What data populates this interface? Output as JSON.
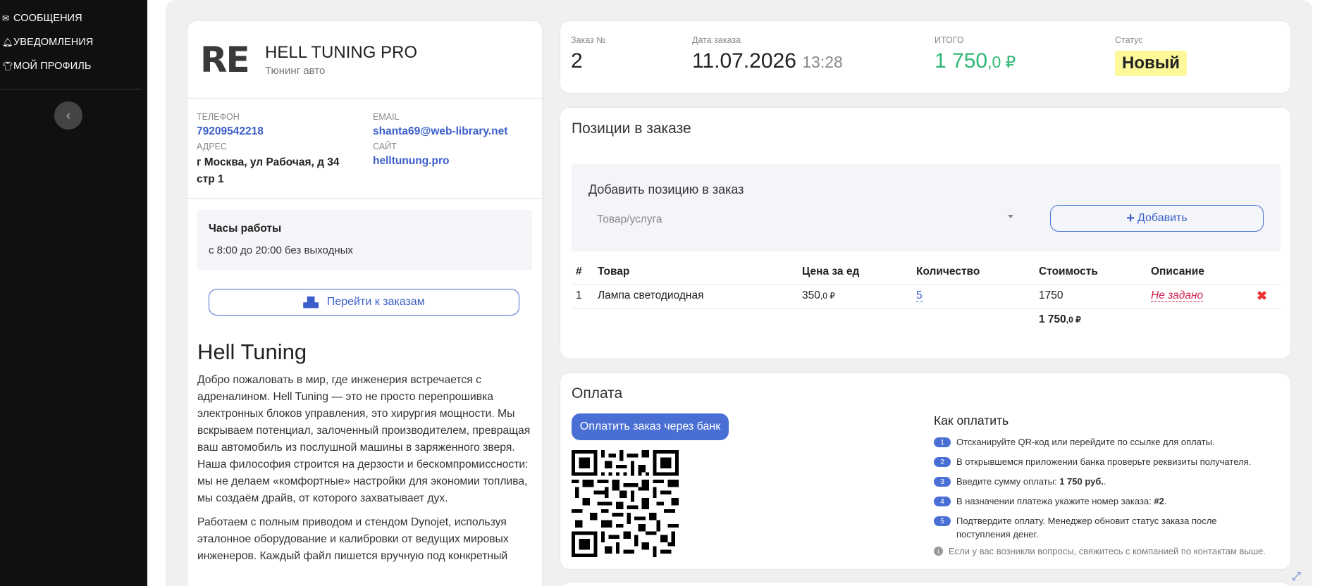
{
  "sidebar": {
    "items": [
      {
        "label": "СООБЩЕНИЯ",
        "icon": "envelope-icon"
      },
      {
        "label": "УВЕДОМЛЕНИЯ",
        "icon": "bell-icon"
      },
      {
        "label": "МОЙ ПРОФИЛЬ",
        "icon": "shirt-icon"
      }
    ],
    "collapse_glyph": "‹"
  },
  "company": {
    "logo": "RE",
    "name": "HELL TUNING PRO",
    "subtitle": "Тюнинг авто",
    "phone_label": "ТЕЛЕФОН",
    "phone": "79209542218",
    "email_label": "EMAIL",
    "email": "shanta69@web-library.net",
    "address_label": "АДРЕС",
    "address": "г Москва, ул Рабочая, д 34 стр 1",
    "site_label": "САЙТ",
    "site": "helltunung.pro",
    "hours_title": "Часы работы",
    "hours_text": "с 8:00 до 20:00 без выходных",
    "orders_button": "Перейти к заказам",
    "about_title": "Hell Tuning",
    "about_p1": "Добро пожаловать в мир, где инженерия встречается с адреналином. Hell Tuning — это не просто перепрошивка электронных блоков управления, это хирургия мощности. Мы вскрываем потенциал, залоченный производителем, превращая ваш автомобиль из послушной машины в заряженного зверя. Наша философия строится на дерзости и бескомпромиссности: мы не делаем «комфортные» настройки для экономии топлива, мы создаём драйв, от которого захватывает дух.",
    "about_p2": "Работаем с полным приводом и стендом Dynojet, используя эталонное оборудование и калибровки от ведущих мировых инженеров. Каждый файл пишется вручную под конкретный"
  },
  "order": {
    "number_label": "Заказ №",
    "number": "2",
    "date_label": "Дата заказа",
    "date": "11.07.2026",
    "time": "13:28",
    "total_label": "ИТОГО",
    "total_int": "1 750",
    "total_frac": ",0 ₽",
    "status_label": "Статус",
    "status": "Новый"
  },
  "positions": {
    "title": "Позиции в заказе",
    "add_title": "Добавить позицию в заказ",
    "select_placeholder": "Товар/услуга",
    "add_button": "Добавить",
    "columns": [
      "#",
      "Товар",
      "Цена за ед",
      "Количество",
      "Стоимость",
      "Описание"
    ],
    "rows": [
      {
        "n": "1",
        "product": "Лампа светодиодная",
        "price_int": "350",
        "price_frac": ",0 ₽",
        "qty": "5",
        "cost": "1750",
        "desc": "Не задано"
      }
    ],
    "sum_int": "1 750",
    "sum_frac": ",0 ₽"
  },
  "payment": {
    "title": "Оплата",
    "pay_button": "Оплатить заказ через банк",
    "how_title": "Как оплатить",
    "steps": [
      {
        "n": "1",
        "text": "Отсканируйте QR-код или перейдите по ссылке для оплаты."
      },
      {
        "n": "2",
        "text": "В открывшемся приложении банка проверьте реквизиты получателя."
      },
      {
        "n": "3",
        "pre": "Введите сумму оплаты: ",
        "bold": "1 750 руб.",
        "post": "."
      },
      {
        "n": "4",
        "pre": "В назначении платежа укажите номер заказа: ",
        "bold": "#2",
        "post": "."
      },
      {
        "n": "5",
        "text": "Подтвердите оплату. Менеджер обновит статус заказа после поступления денег."
      }
    ],
    "note": "Если у вас возникли вопросы, свяжитесь с компанией по контактам выше."
  },
  "colors": {
    "accent": "#4a6fd4",
    "green": "#2eb872",
    "status_bg": "#fdf89a",
    "danger": "#d42050"
  }
}
